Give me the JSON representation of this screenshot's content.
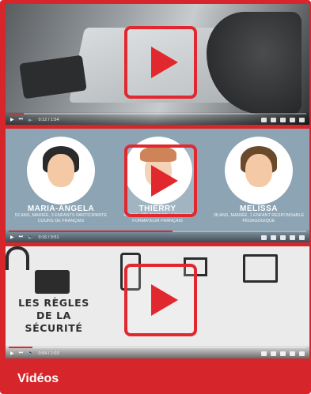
{
  "section_title": "Vidéos",
  "colors": {
    "accent": "#d7262b",
    "play": "#e0282e"
  },
  "videos": [
    {
      "id_label": "video-1",
      "time": "0:12 / 1:54",
      "progress": 0.05
    },
    {
      "id_label": "video-2",
      "time": "0:16 / 0:51",
      "progress": 0.55,
      "people": [
        {
          "name": "MARIA-ANGELA",
          "desc": "52 ans, mariée, 3 enfants participante cours de français"
        },
        {
          "name": "THIERRY",
          "desc": "45 ans, célibataire, 1 enfant formateur français"
        },
        {
          "name": "MELISSA",
          "desc": "38 ans, mariée, 1 enfant responsable pédagogique"
        }
      ]
    },
    {
      "id_label": "video-3",
      "time": "0:04 / 1:03",
      "progress": 0.08,
      "slide_text": [
        "LES RÈGLES",
        "DE LA",
        "SÉCURITÉ"
      ]
    }
  ],
  "icons": {
    "play": "play-icon",
    "skip": "skip-next-icon",
    "volume": "volume-icon",
    "settings": "gear-icon",
    "fullscreen": "fullscreen-icon"
  }
}
